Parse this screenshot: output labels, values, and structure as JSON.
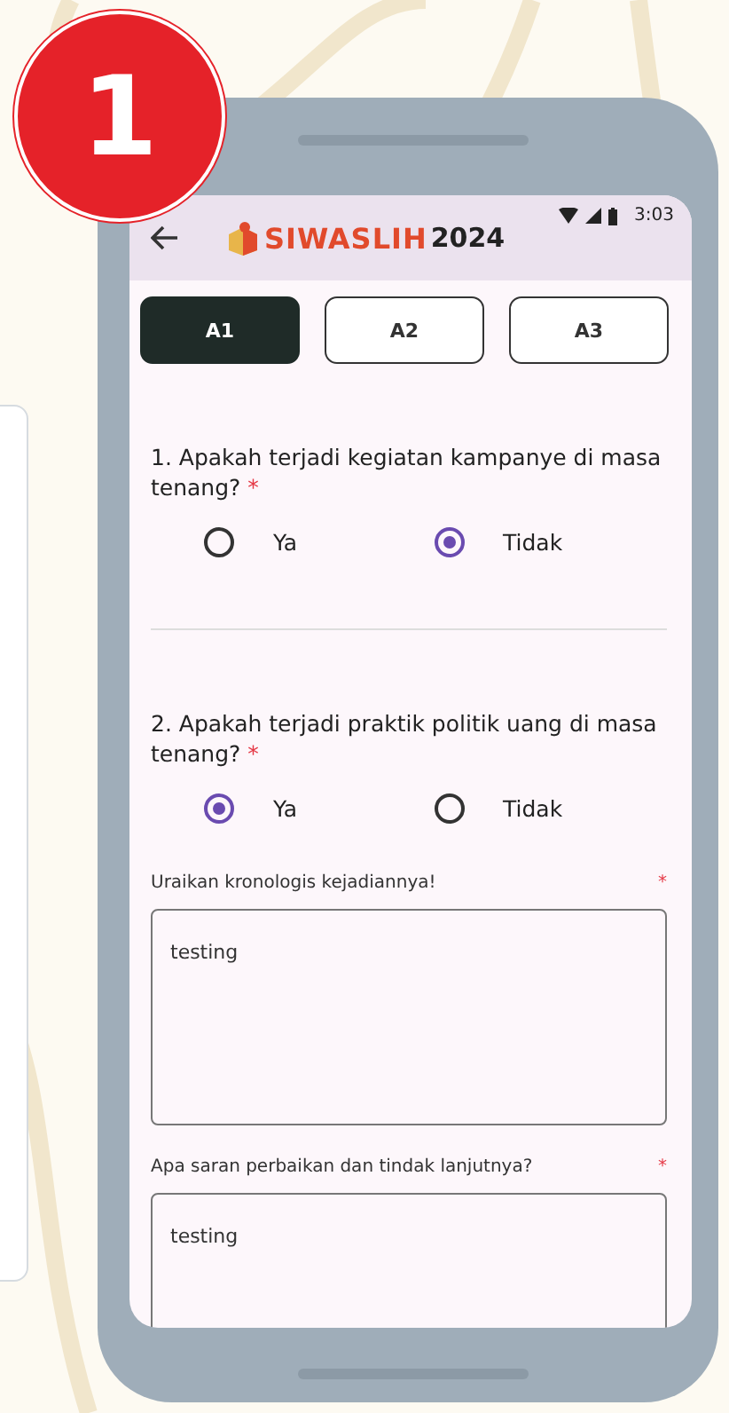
{
  "badge": "1",
  "status_bar": {
    "time": "3:03"
  },
  "app_bar": {
    "logo_text": "SIWASLIH",
    "logo_year": "2024"
  },
  "tabs": [
    {
      "label": "A1",
      "selected": true
    },
    {
      "label": "A2",
      "selected": false
    },
    {
      "label": "A3",
      "selected": false
    }
  ],
  "questions": [
    {
      "text": "1. Apakah terjadi kegiatan kampanye di masa tenang?",
      "marker": "*",
      "options": [
        {
          "label": "Ya",
          "selected": false
        },
        {
          "label": "Tidak",
          "selected": true
        }
      ]
    },
    {
      "text": "2. Apakah terjadi praktik politik uang di masa tenang?",
      "marker": "*",
      "options": [
        {
          "label": "Ya",
          "selected": true
        },
        {
          "label": "Tidak",
          "selected": false
        }
      ]
    }
  ],
  "fields": [
    {
      "label": "Uraikan kronologis kejadiannya!",
      "marker": "*",
      "value": "testing"
    },
    {
      "label": "Apa saran perbaikan dan tindak lanjutnya?",
      "marker": "*",
      "value": "testing"
    }
  ]
}
